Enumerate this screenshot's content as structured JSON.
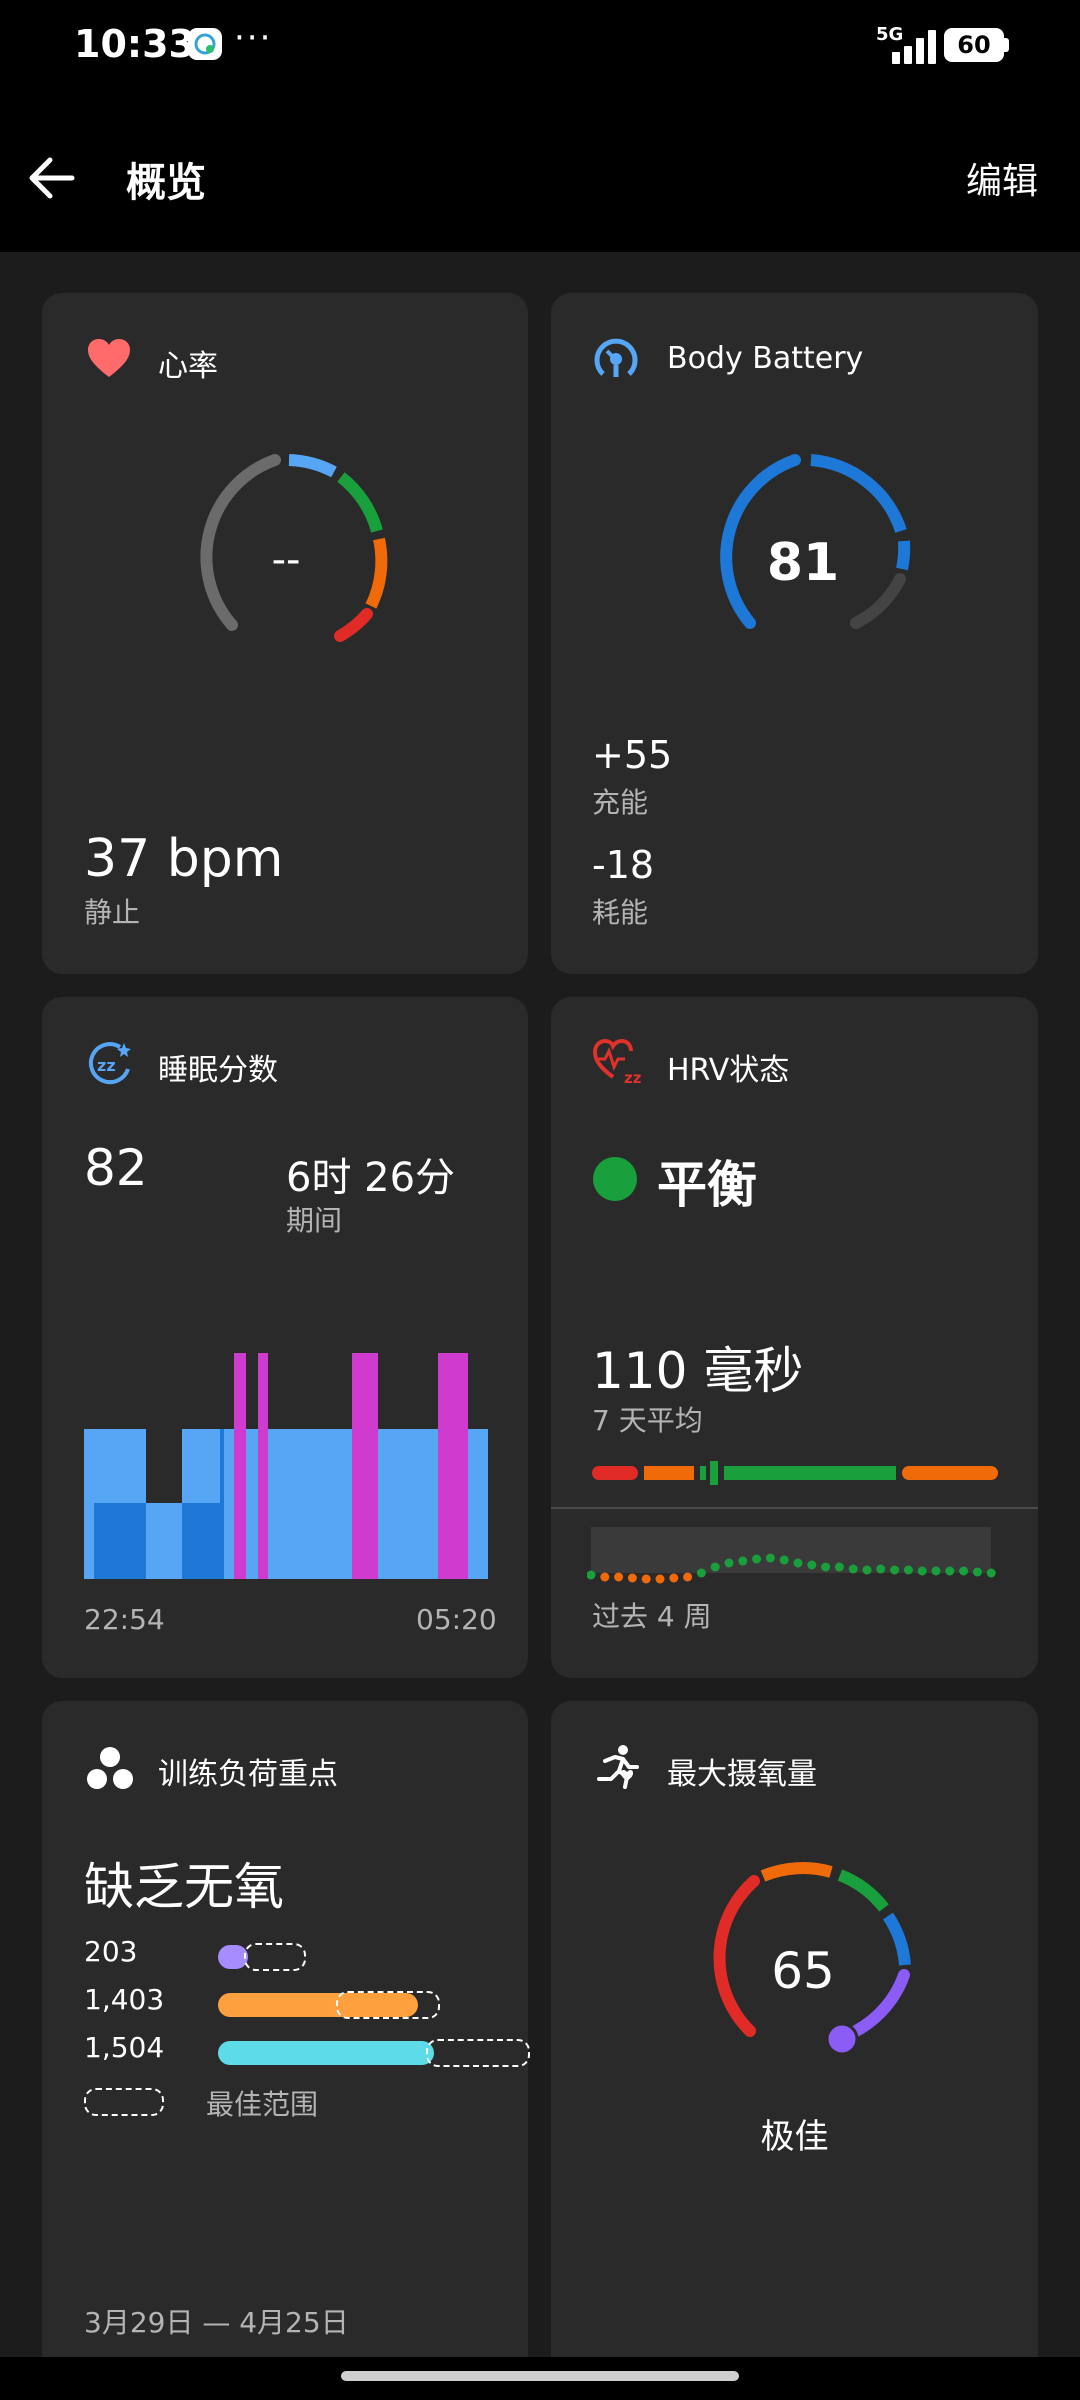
{
  "status_bar": {
    "time": "10:33",
    "overflow": "···",
    "network": "5G",
    "battery": "60"
  },
  "header": {
    "title": "概览",
    "edit_label": "编辑"
  },
  "heart_rate": {
    "title": "心率",
    "current": "--",
    "value": "37 bpm",
    "label": "静止"
  },
  "body_battery": {
    "title": "Body Battery",
    "value": "81",
    "charged": "+55",
    "charged_label": "充能",
    "drained": "-18",
    "drained_label": "耗能",
    "level": 0.81
  },
  "sleep": {
    "title": "睡眠分数",
    "score": "82",
    "duration": "6时 26分",
    "duration_label": "期间",
    "start_time": "22:54",
    "end_time": "05:20"
  },
  "hrv": {
    "title": "HRV状态",
    "status": "平衡",
    "value": "110 毫秒",
    "label": "7 天平均",
    "period_label": "过去 4 周"
  },
  "training_load": {
    "title": "训练负荷重点",
    "status": "缺乏无氧",
    "rows": [
      {
        "value": "203",
        "color": "#a68cff"
      },
      {
        "value": "1,403",
        "color": "#ff9f3e"
      },
      {
        "value": "1,504",
        "color": "#5ddce8"
      }
    ],
    "legend_label": "最佳范围",
    "date_range": "3月29日 — 4月25日"
  },
  "vo2max": {
    "title": "最大摄氧量",
    "value": "65",
    "label": "极佳"
  },
  "colors": {
    "background": "#1c1c1c",
    "card": "#2a2a2a",
    "red": "#e02b27",
    "orange": "#f06a0a",
    "green": "#19a03c",
    "blue": "#1e78d7",
    "light_blue": "#56a6f5",
    "purple": "#8b5cf6",
    "magenta": "#cf3bcf"
  },
  "icons": [
    "back-arrow-icon",
    "heart-icon",
    "body-battery-icon",
    "sleep-icon",
    "hrv-icon",
    "training-load-icon",
    "running-icon"
  ]
}
